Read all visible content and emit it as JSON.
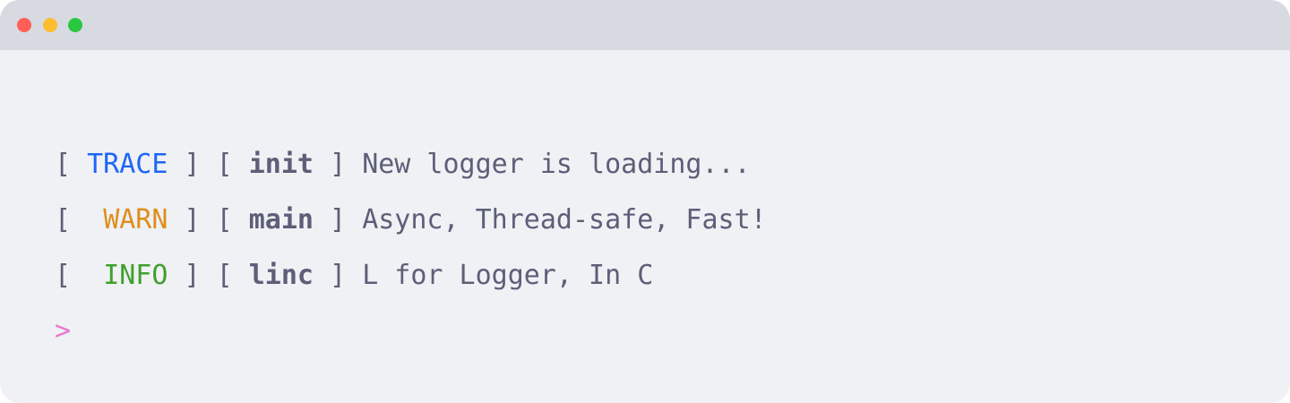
{
  "colors": {
    "window_bg": "#eff1f5",
    "titlebar_bg": "#d8dae2",
    "text": "#5c5f77",
    "close": "#ff5f57",
    "minimize": "#febc2e",
    "maximize": "#28c840",
    "trace": "#1e66f5",
    "warn": "#df8e1d",
    "info": "#40a02b",
    "prompt": "#ea76cb"
  },
  "titlebar": {
    "buttons": [
      "close-icon",
      "minimize-icon",
      "maximize-icon"
    ]
  },
  "log": [
    {
      "bracket_open": "[ ",
      "level": "TRACE",
      "level_pad": "",
      "bracket_mid": " ] [ ",
      "tag": "init",
      "bracket_close": " ] ",
      "message": "New logger is loading...",
      "level_color": "trace"
    },
    {
      "bracket_open": "[ ",
      "level": "WARN",
      "level_pad": " ",
      "bracket_mid": " ] [ ",
      "tag": "main",
      "bracket_close": " ] ",
      "message": "Async, Thread-safe, Fast!",
      "level_color": "warn"
    },
    {
      "bracket_open": "[ ",
      "level": "INFO",
      "level_pad": " ",
      "bracket_mid": " ] [ ",
      "tag": "linc",
      "bracket_close": " ] ",
      "message": "L for Logger, In C",
      "level_color": "info"
    }
  ],
  "prompt": ">"
}
